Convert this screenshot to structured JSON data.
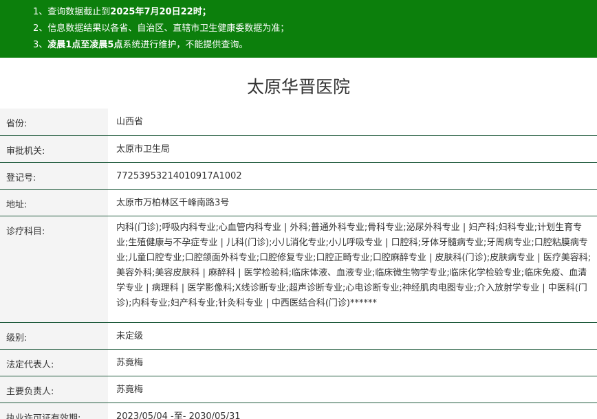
{
  "notice": {
    "line1_prefix": "1、查询数据截止到",
    "line1_bold": "2025年7月20日22时",
    "line1_suffix": "；",
    "line2": "2、信息数据结果以各省、自治区、直辖市卫生健康委数据为准；",
    "line3_prefix": "3、",
    "line3_bold": "凌晨1点至凌晨5点",
    "line3_suffix": "系统进行维护，不能提供查询。"
  },
  "hospital_name": "太原华晋医院",
  "rows": [
    {
      "label": "省份:",
      "value": "山西省"
    },
    {
      "label": "审批机关:",
      "value": "太原市卫生局"
    },
    {
      "label": "登记号:",
      "value": "77253953214010917A1002"
    },
    {
      "label": "地址:",
      "value": "太原市万柏林区千峰南路3号"
    },
    {
      "label": "诊疗科目:",
      "value": "内科(门诊);呼吸内科专业;心血管内科专业 | 外科;普通外科专业;骨科专业;泌尿外科专业 | 妇产科;妇科专业;计划生育专业;生殖健康与不孕症专业 | 儿科(门诊);小儿消化专业;小儿呼吸专业 | 口腔科;牙体牙髓病专业;牙周病专业;口腔粘膜病专业;儿童口腔专业;口腔颌面外科专业;口腔修复专业;口腔正畸专业;口腔麻醉专业 | 皮肤科(门诊);皮肤病专业 | 医疗美容科;美容外科;美容皮肤科 | 麻醉科 | 医学检验科;临床体液、血液专业;临床微生物学专业;临床化学检验专业;临床免疫、血清学专业 | 病理科 | 医学影像科;X线诊断专业;超声诊断专业;心电诊断专业;神经肌肉电图专业;介入放射学专业 | 中医科(门诊);内科专业;妇产科专业;针灸科专业 | 中西医结合科(门诊)******"
    },
    {
      "label": "级别:",
      "value": "未定级"
    },
    {
      "label": "法定代表人:",
      "value": "苏竟梅"
    },
    {
      "label": "主要负责人:",
      "value": "苏竟梅"
    },
    {
      "label": "执业许可证有效期:",
      "value": "2023/05/04 -至- 2030/05/31"
    }
  ]
}
